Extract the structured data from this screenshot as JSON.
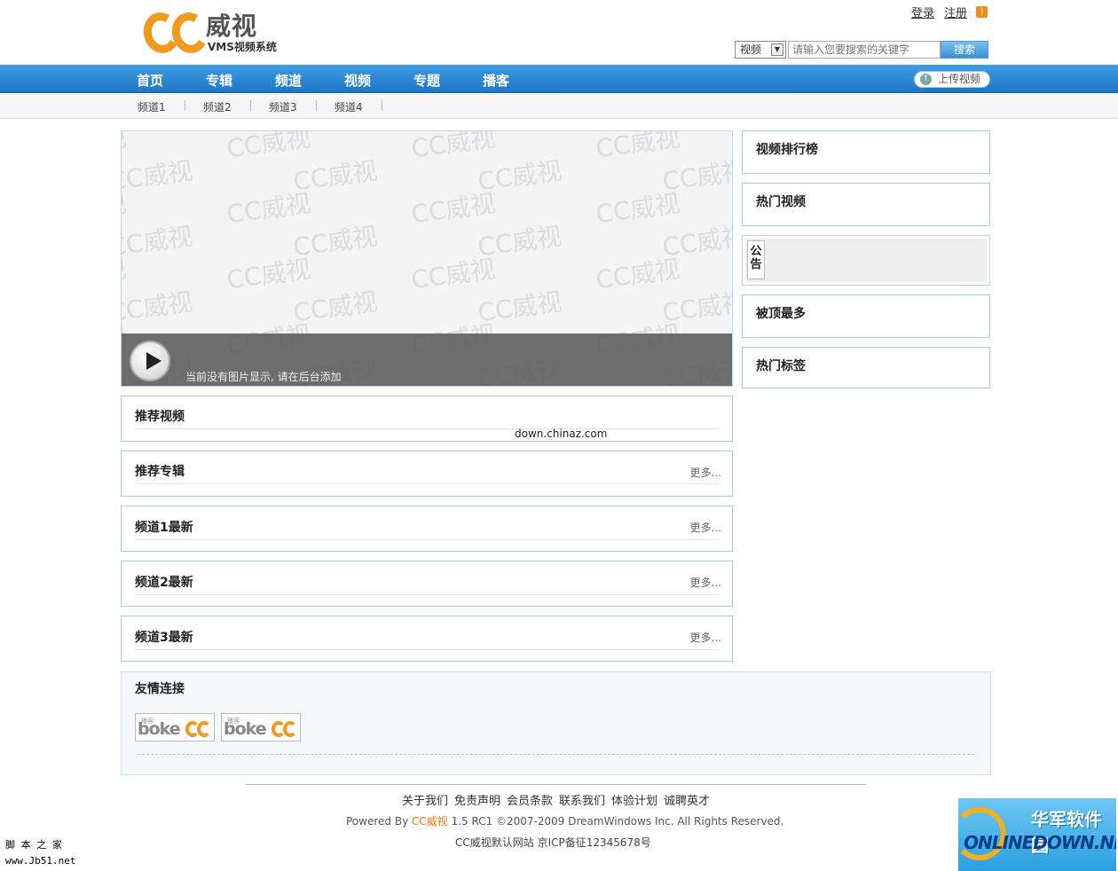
{
  "brand": {
    "logo_title": "威视",
    "logo_subtitle": "VMS视频系统"
  },
  "top_links": {
    "login": "登录",
    "register": "注册",
    "rss_icon": "rss-icon"
  },
  "search": {
    "category": "视频",
    "placeholder": "请输入您要搜索的关键字",
    "button": "搜索"
  },
  "nav": {
    "items": [
      "首页",
      "专辑",
      "频道",
      "视频",
      "专题",
      "播客"
    ],
    "upload": "上传视频"
  },
  "subnav": {
    "items": [
      "频道1",
      "频道2",
      "频道3",
      "频道4"
    ]
  },
  "slider": {
    "watermark": "CC威视",
    "caption": "当前没有图片显示, 请在后台添加"
  },
  "watermark_site": "down.chinaz.com",
  "main_sections": [
    {
      "title": "推荐视频",
      "more": ""
    },
    {
      "title": "推荐专辑",
      "more": "更多..."
    },
    {
      "title": "频道1最新",
      "more": "更多..."
    },
    {
      "title": "频道2最新",
      "more": "更多..."
    },
    {
      "title": "频道3最新",
      "more": "更多..."
    }
  ],
  "sidebar": {
    "rank": "视频排行榜",
    "hot_videos": "热门视频",
    "notice": "公告",
    "most_voted": "被顶最多",
    "hot_tags": "热门标签"
  },
  "friend_links": {
    "title": "友情连接",
    "logo_text": "boke",
    "logo_small": "播客"
  },
  "footer": {
    "links": [
      "关于我们",
      "免责声明",
      "会员条款",
      "联系我们",
      "体验计划",
      "诚聘英才"
    ],
    "powered_prefix": "Powered By ",
    "powered_brand": "CC威视",
    "powered_suffix": " 1.5 RC1   ©2007-2009 DreamWindows Inc. All Rights Reserved.",
    "icp": "CC威视默认网站   京ICP备征12345678号"
  },
  "site_watermarks": {
    "bl_line1": "脚 本 之 家",
    "bl_line2": "www.Jb51.net",
    "br_cn": "华军软件园",
    "br_en": "ONLINEDOWN.NET"
  },
  "colors": {
    "nav_blue": "#2a86d4",
    "accent_orange": "#f09a1e",
    "box_border": "#a9c9e6"
  }
}
